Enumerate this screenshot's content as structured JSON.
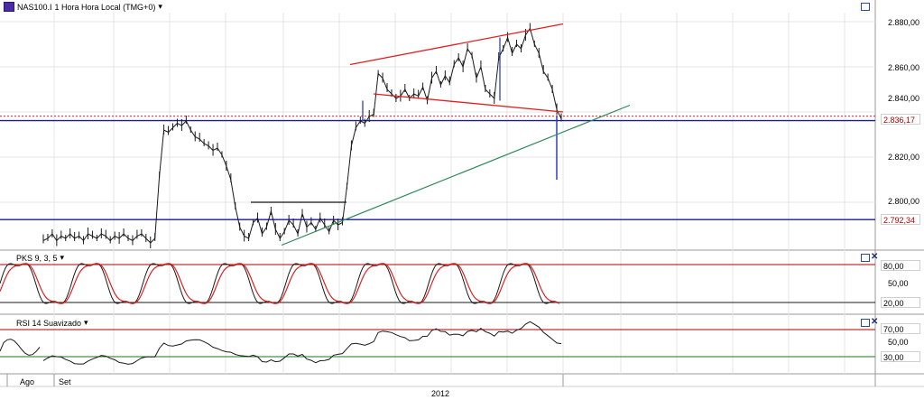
{
  "header": {
    "symbol": "NAS100.I",
    "title": "1 Hora Hora Local (TMG+0)",
    "dropdown_glyph": "▾"
  },
  "colors": {
    "price_line": "#1a1a1a",
    "channel": "#e02020",
    "support_blue": "#1a1aa0",
    "trendline": "#2f8a5a",
    "stoch_k": "#1a1a1a",
    "stoch_d": "#e02020",
    "grid": "#e4e4e4"
  },
  "chart_data": [
    {
      "type": "line",
      "panel": "price",
      "yticks": [
        "2.880,00",
        "2.860,00",
        "2.840,00",
        "2.820,00",
        "2.800,00"
      ],
      "ylim": [
        2782,
        2888
      ],
      "price_tags": [
        {
          "label": "2.836,17",
          "value": 2836.17
        },
        {
          "label": "2.792,34",
          "value": 2792.34
        }
      ],
      "series": [
        {
          "values": [
            2783,
            2784,
            2786,
            2783,
            2785,
            2784,
            2786,
            2784,
            2785,
            2783,
            2786,
            2785,
            2784,
            2786,
            2785,
            2783,
            2785,
            2784,
            2786,
            2784,
            2783,
            2785,
            2786,
            2784,
            2782,
            2784,
            2812,
            2832,
            2831,
            2833,
            2835,
            2834,
            2836,
            2832,
            2829,
            2828,
            2826,
            2825,
            2823,
            2824,
            2821,
            2816,
            2810,
            2798,
            2789,
            2785,
            2784,
            2791,
            2793,
            2786,
            2789,
            2796,
            2788,
            2784,
            2787,
            2792,
            2790,
            2786,
            2795,
            2789,
            2791,
            2788,
            2793,
            2790,
            2787,
            2792,
            2790,
            2791,
            2807,
            2825,
            2833,
            2836,
            2835,
            2838,
            2839,
            2857,
            2855,
            2850,
            2848,
            2846,
            2847,
            2850,
            2846,
            2848,
            2847,
            2851,
            2845,
            2855,
            2858,
            2852,
            2856,
            2853,
            2861,
            2864,
            2860,
            2868,
            2865,
            2855,
            2860,
            2850,
            2848,
            2846,
            2864,
            2868,
            2873,
            2866,
            2870,
            2868,
            2874,
            2877,
            2870,
            2866,
            2858,
            2855,
            2850,
            2841,
            2837
          ],
          "x_start_index": 48
        }
      ],
      "overlay_levels": [
        2836.17,
        2792.34,
        2838.14
      ]
    },
    {
      "type": "line",
      "panel": "oscillator",
      "title": "PKS 9, 3, 5",
      "yticks": [
        "80,00",
        "50,00",
        "20,00"
      ],
      "ylim": [
        0,
        100
      ],
      "levels": [
        80,
        20
      ]
    },
    {
      "type": "line",
      "panel": "oscillator",
      "title": "RSI 14 Suavizado",
      "yticks": [
        "70,00",
        "50,00",
        "30,00"
      ],
      "ylim": [
        0,
        100
      ],
      "levels": [
        70,
        30
      ]
    }
  ],
  "xaxis": {
    "labels": [
      {
        "text": "Ago"
      },
      {
        "text": "Set"
      }
    ],
    "year_label": "2012"
  },
  "panel_buttons": {
    "minimize": "□",
    "close": "✕"
  }
}
